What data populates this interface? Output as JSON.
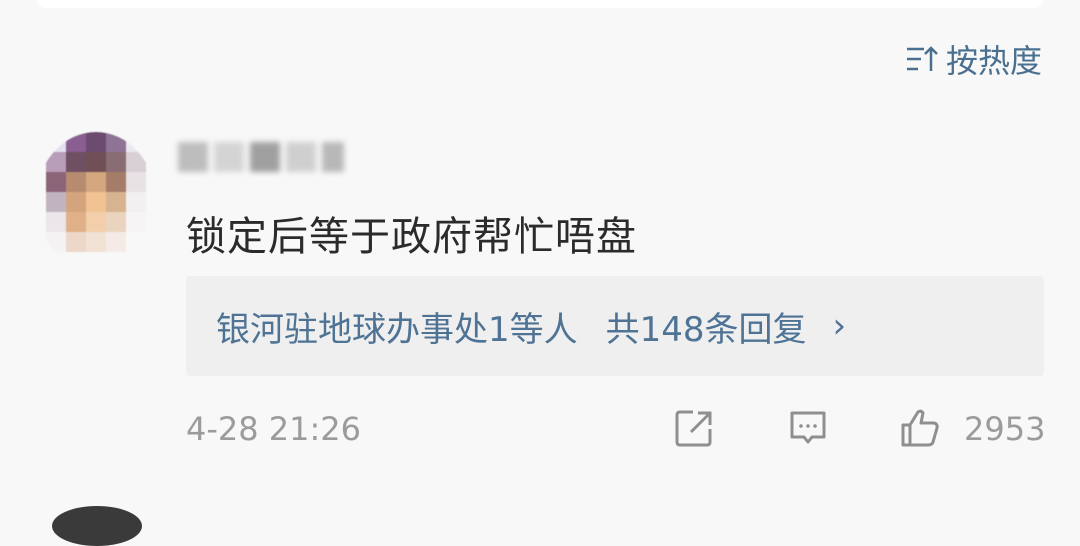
{
  "sort": {
    "label": "按热度",
    "icon": "sort-icon"
  },
  "comment": {
    "text": "锁定后等于政府帮忙唔盘",
    "replies": {
      "users": "银河驻地球办事处1等人",
      "count": "共148条回复",
      "arrow": "›"
    },
    "timestamp": "4-28 21:26",
    "like_count": "2953",
    "icons": {
      "share": "share-icon",
      "comment": "comment-icon",
      "like": "like-icon"
    }
  },
  "colors": {
    "background": "#f8f8f8",
    "accent": "#4f7394",
    "meta_text": "#9b9b9b",
    "reply_background": "#efefef"
  }
}
